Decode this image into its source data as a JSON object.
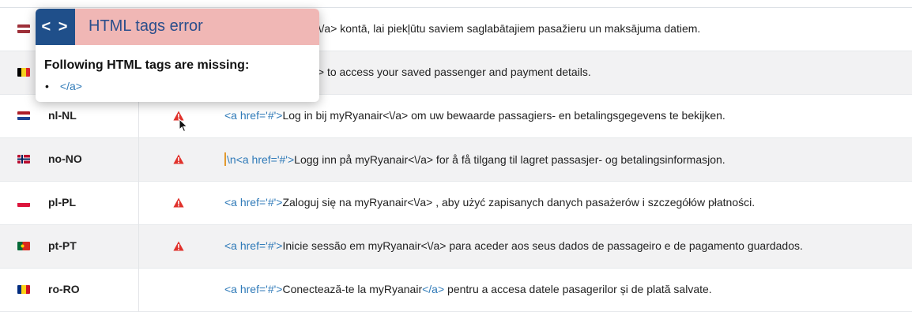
{
  "popover": {
    "title": "HTML tags error",
    "code_icon": "< >",
    "message": "Following HTML tags are missing:",
    "missing_tags": [
      "</a>"
    ]
  },
  "rows": [
    {
      "locale": "",
      "warning": false,
      "text_prefix": "",
      "tag_open": "",
      "text": "kieties myRyanair<\\/a> kontā, lai piekļūtu saviem saglabātajiem pasažieru un maksājuma datiem.",
      "tag_close": "",
      "text_after": "",
      "flag": [
        "#9e3039",
        "#ffffff",
        "#9e3039"
      ]
    },
    {
      "locale": "",
      "warning": false,
      "text_prefix": "",
      "tag_open": "",
      "text": "n to myRyanair<\\/a> to access your saved passenger and payment details.",
      "tag_close": "",
      "text_after": "",
      "flag": [
        "#000000",
        "#f5d21f",
        "#e0262d"
      ]
    },
    {
      "locale": "nl-NL",
      "warning": true,
      "text_prefix": "",
      "tag_open": "<a href='#'>",
      "text": "Log in bij myRyanair<\\/a> om uw bewaarde passagiers- en betalingsgegevens te bekijken.",
      "tag_close": "",
      "text_after": "",
      "flag": [
        "#ad1d28",
        "#ffffff",
        "#1e4595"
      ]
    },
    {
      "locale": "no-NO",
      "warning": true,
      "text_prefix": "\\n",
      "tag_open": "<a href='#'>",
      "text": "Logg inn på myRyanair<\\/a> for å få tilgang til lagret passasjer- og betalingsinformasjon.",
      "tag_close": "",
      "text_after": "",
      "flag": [
        "#ba0c2f",
        "#ffffff",
        "#00205b"
      ]
    },
    {
      "locale": "pl-PL",
      "warning": true,
      "text_prefix": "",
      "tag_open": "<a href='#'>",
      "text": "Zaloguj się na myRyanair<\\/a> , aby użyć zapisanych danych pasażerów i szczegółów płatności.",
      "tag_close": "",
      "text_after": "",
      "flag": [
        "#ffffff",
        "#dc143c"
      ]
    },
    {
      "locale": "pt-PT",
      "warning": true,
      "text_prefix": "",
      "tag_open": "<a href='#'>",
      "text": "Inicie sessão em myRyanair<\\/a> para aceder aos seus dados de passageiro e de pagamento guardados.",
      "tag_close": "",
      "text_after": "",
      "flag": [
        "#046a38",
        "#da291c"
      ]
    },
    {
      "locale": "ro-RO",
      "warning": false,
      "text_prefix": "",
      "tag_open": "<a href='#'>",
      "text": "Conectează-te la myRyanair",
      "tag_close": "</a>",
      "text_after": " pentru a accesa datele pasagerilor și de plată salvate.",
      "flag": [
        "#002b7f",
        "#fcd116",
        "#ce1126"
      ]
    }
  ],
  "colors": {
    "popover_header": "#f0b7b5",
    "code_badge": "#1f4f8a",
    "warning": "#e0312b",
    "tag_text": "#2f7ab8",
    "row_alt": "#f2f2f3"
  }
}
